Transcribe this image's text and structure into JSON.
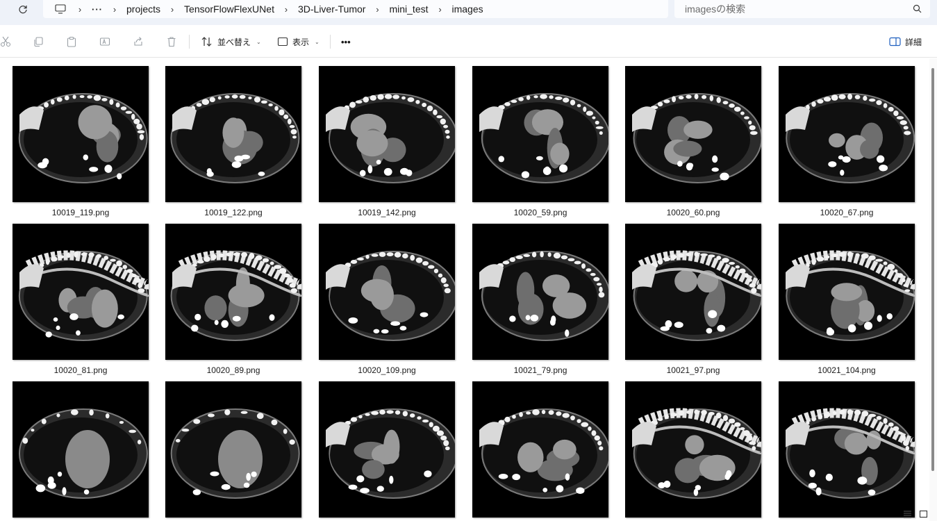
{
  "breadcrumb": {
    "overflow": "···",
    "items": [
      "projects",
      "TensorFlowFlexUNet",
      "3D-Liver-Tumor",
      "mini_test",
      "images"
    ]
  },
  "search": {
    "placeholder": "imagesの検索"
  },
  "toolbar": {
    "sort_label": "並べ替え",
    "view_label": "表示",
    "more_label": "•••",
    "details_label": "詳細"
  },
  "icons": {
    "refresh": "refresh-icon",
    "computer": "computer-icon",
    "search": "search-icon",
    "cut": "cut-icon",
    "copy": "copy-icon",
    "paste": "paste-icon",
    "rename": "rename-icon",
    "share": "share-icon",
    "delete": "delete-icon",
    "sort": "sort-icon",
    "view": "view-icon",
    "details": "details-pane-icon",
    "list_view": "list-view-icon",
    "tile_view": "tile-view-icon"
  },
  "colors": {
    "titlebar_bg": "#eef2f9",
    "thumb_bg": "#000000"
  },
  "files": [
    {
      "name": "10019_119.png",
      "kind": "ribs"
    },
    {
      "name": "10019_122.png",
      "kind": "ribs"
    },
    {
      "name": "10019_142.png",
      "kind": "ribs"
    },
    {
      "name": "10020_59.png",
      "kind": "organs"
    },
    {
      "name": "10020_60.png",
      "kind": "organs"
    },
    {
      "name": "10020_67.png",
      "kind": "organs"
    },
    {
      "name": "10020_81.png",
      "kind": "spine"
    },
    {
      "name": "10020_89.png",
      "kind": "spine"
    },
    {
      "name": "10020_109.png",
      "kind": "organs"
    },
    {
      "name": "10021_79.png",
      "kind": "ribs"
    },
    {
      "name": "10021_97.png",
      "kind": "spine"
    },
    {
      "name": "10021_104.png",
      "kind": "spine"
    },
    {
      "name": "",
      "kind": "axial"
    },
    {
      "name": "",
      "kind": "axial"
    },
    {
      "name": "",
      "kind": "organs"
    },
    {
      "name": "",
      "kind": "organs"
    },
    {
      "name": "",
      "kind": "spine"
    },
    {
      "name": "",
      "kind": "spine"
    }
  ]
}
